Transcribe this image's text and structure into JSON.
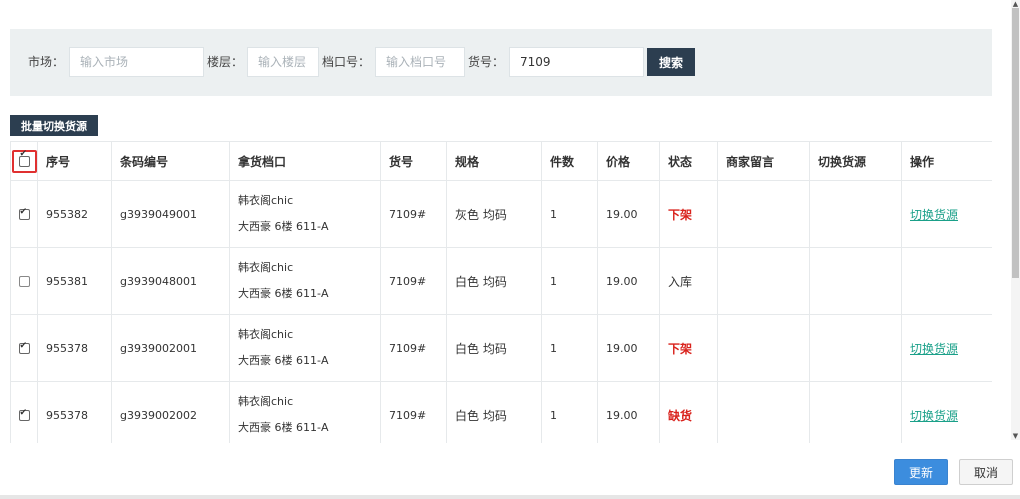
{
  "search": {
    "market_label": "市场：",
    "market_placeholder": "输入市场",
    "floor_label": "楼层：",
    "floor_placeholder": "输入楼层",
    "stall_label": "档口号：",
    "stall_placeholder": "输入档口号",
    "item_label": "货号：",
    "item_value": "7109",
    "search_button": "搜索"
  },
  "batch_button": "批量切换货源",
  "table": {
    "headers": [
      "序号",
      "条码编号",
      "拿货档口",
      "货号",
      "规格",
      "件数",
      "价格",
      "状态",
      "商家留言",
      "切换货源",
      "操作"
    ],
    "header_checkbox_checked": true,
    "rows": [
      {
        "checked": true,
        "id": "955382",
        "barcode": "g3939049001",
        "stall_name": "韩衣阁chic",
        "stall_location": "大西豪 6楼 611-A",
        "item_no": "7109#",
        "spec": "灰色 均码",
        "qty": "1",
        "price": "19.00",
        "status": "下架",
        "status_color": "#d9221c",
        "message": "",
        "switch": "",
        "action": "切换货源"
      },
      {
        "checked": false,
        "id": "955381",
        "barcode": "g3939048001",
        "stall_name": "韩衣阁chic",
        "stall_location": "大西豪 6楼 611-A",
        "item_no": "7109#",
        "spec": "白色 均码",
        "qty": "1",
        "price": "19.00",
        "status": "入库",
        "status_color": "#333333",
        "message": "",
        "switch": "",
        "action": ""
      },
      {
        "checked": true,
        "id": "955378",
        "barcode": "g3939002001",
        "stall_name": "韩衣阁chic",
        "stall_location": "大西豪 6楼 611-A",
        "item_no": "7109#",
        "spec": "白色 均码",
        "qty": "1",
        "price": "19.00",
        "status": "下架",
        "status_color": "#d9221c",
        "message": "",
        "switch": "",
        "action": "切换货源"
      },
      {
        "checked": true,
        "id": "955378",
        "barcode": "g3939002002",
        "stall_name": "韩衣阁chic",
        "stall_location": "大西豪 6楼 611-A",
        "item_no": "7109#",
        "spec": "白色 均码",
        "qty": "1",
        "price": "19.00",
        "status": "缺货",
        "status_color": "#d9221c",
        "message": "",
        "switch": "",
        "action": "切换货源"
      }
    ]
  },
  "footer": {
    "update_button": "更新",
    "cancel_button": "取消"
  },
  "colors": {
    "panel_bg": "#ecf0f1",
    "dark_button": "#2c3e50",
    "primary_button": "#3c8dde",
    "link": "#1aa089",
    "alert_red": "#d9221c",
    "highlight_border": "#e03030"
  }
}
